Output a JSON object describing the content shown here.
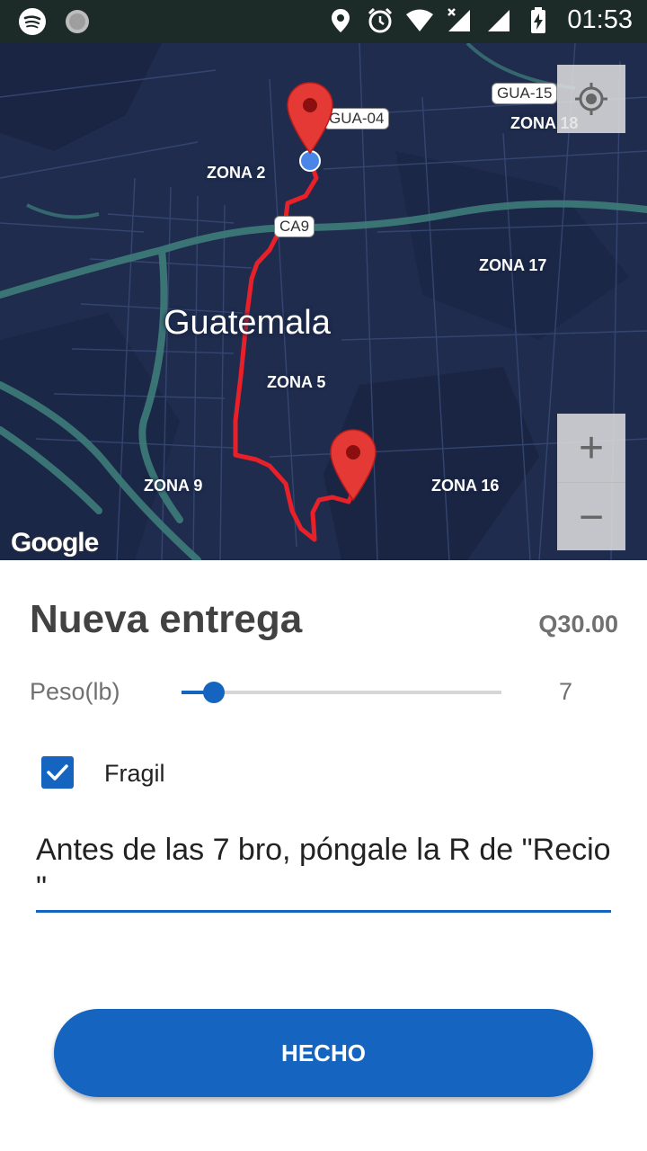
{
  "status_bar": {
    "left_icons": [
      "spotify-icon",
      "generic-app-icon"
    ],
    "right_icons": [
      "location-icon",
      "alarm-icon",
      "wifi-icon",
      "mobile-signal-icon",
      "signal-icon",
      "battery-charging-icon"
    ],
    "time": "01:53"
  },
  "map": {
    "city_label": "Guatemala",
    "zones": {
      "zona2": "ZONA 2",
      "zona18": "ZONA 18",
      "zona17": "ZONA 17",
      "zona5": "ZONA 5",
      "zona9": "ZONA 9",
      "zona16": "ZONA 16"
    },
    "shields": {
      "gua04": "GUA-04",
      "gua15": "GUA-15",
      "ca9": "CA9"
    },
    "google_logo": "Google",
    "zoom_in": "+",
    "zoom_out": "−",
    "route_color": "#e8202a",
    "pin_color": "#e53935",
    "origin_color": "#4a86e8"
  },
  "form": {
    "title": "Nueva entrega",
    "price": "Q30.00",
    "peso_label": "Peso(lb)",
    "peso_value": "7",
    "peso_fraction": 0.1,
    "fragil_label": "Fragil",
    "fragil_checked": true,
    "note_text": "Antes de las 7 bro, póngale la R de \"Recio                \"",
    "done_label": "HECHO"
  },
  "colors": {
    "accent": "#1565c0",
    "map_bg": "#1f2c4d",
    "status_bar": "#1c2b27"
  }
}
